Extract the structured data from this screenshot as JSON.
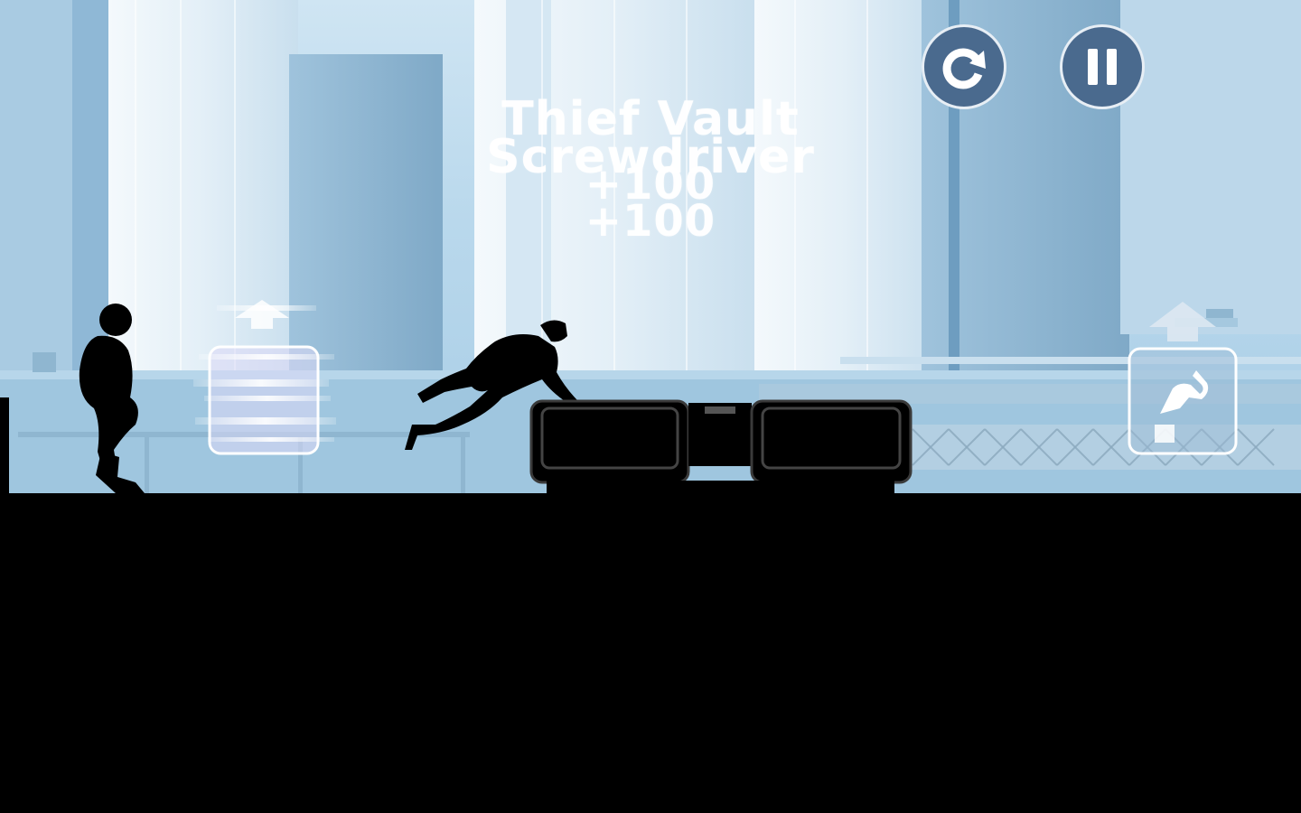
{
  "game": {
    "tricks": [
      {
        "name": "Thief Vault",
        "points": "+100"
      },
      {
        "name": "Screwdriver",
        "points": "+100"
      }
    ]
  },
  "hud": {
    "restart_icon": "restart-icon",
    "pause_icon": "pause-icon",
    "button_fill": "#4a6a8e",
    "button_border": "#e7eef5"
  },
  "scene": {
    "sky_color": "#b9d8ec",
    "ground_color": "#000000",
    "tower_color": "#e6f1f8",
    "pickup_icon": "bonus-crate-icon",
    "trick_card_icon": "jump-trick-icon"
  }
}
